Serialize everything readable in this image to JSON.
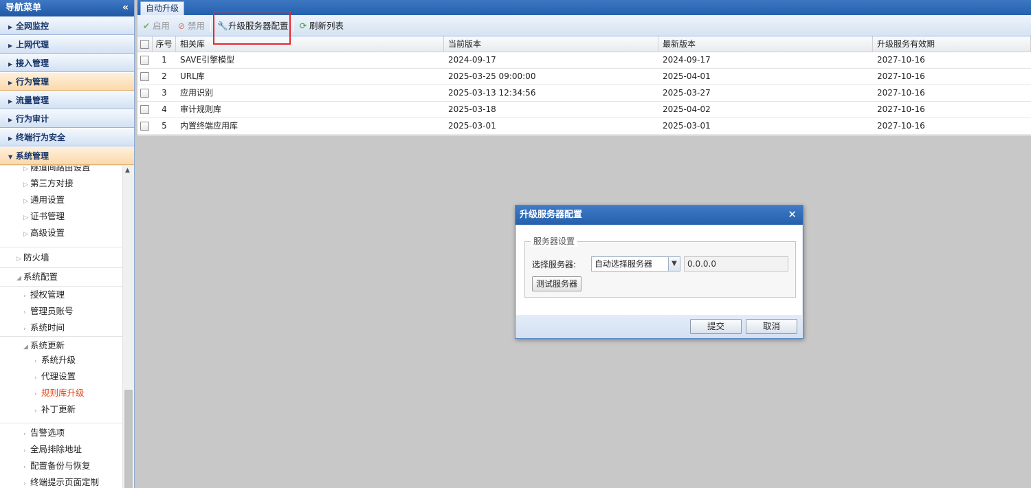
{
  "sidebar": {
    "title": "导航菜单",
    "collapse_glyph": "«",
    "categories": [
      {
        "label": "全网监控"
      },
      {
        "label": "上网代理"
      },
      {
        "label": "接入管理"
      },
      {
        "label": "行为管理"
      },
      {
        "label": "流量管理"
      },
      {
        "label": "行为审计"
      },
      {
        "label": "终端行为安全"
      },
      {
        "label": "系统管理"
      }
    ],
    "tree": [
      {
        "label": "隧道间路由设置"
      },
      {
        "label": "第三方对接"
      },
      {
        "label": "通用设置"
      },
      {
        "label": "证书管理"
      },
      {
        "label": "高级设置"
      },
      {
        "label": "防火墙"
      },
      {
        "label": "系统配置"
      },
      {
        "label": "授权管理"
      },
      {
        "label": "管理员账号"
      },
      {
        "label": "系统时间"
      },
      {
        "label": "系统更新"
      },
      {
        "label": "系统升级"
      },
      {
        "label": "代理设置"
      },
      {
        "label": "规则库升级"
      },
      {
        "label": "补丁更新"
      },
      {
        "label": "告警选项"
      },
      {
        "label": "全局排除地址"
      },
      {
        "label": "配置备份与恢复"
      },
      {
        "label": "终端提示页面定制"
      }
    ]
  },
  "tabs": [
    {
      "label": "自动升级"
    }
  ],
  "toolbar": {
    "enable_label": "启用",
    "disable_label": "禁用",
    "server_config_label": "升级服务器配置",
    "refresh_label": "刷新列表"
  },
  "grid": {
    "headers": {
      "no": "序号",
      "library": "相关库",
      "current": "当前版本",
      "latest": "最新版本",
      "expiry": "升级服务有效期"
    },
    "rows": [
      {
        "no": "1",
        "library": "SAVE引擎模型",
        "current": "2024-09-17",
        "latest": "2024-09-17",
        "expiry": "2027-10-16"
      },
      {
        "no": "2",
        "library": "URL库",
        "current": "2025-03-25 09:00:00",
        "latest": "2025-04-01",
        "expiry": "2027-10-16"
      },
      {
        "no": "3",
        "library": "应用识别",
        "current": "2025-03-13 12:34:56",
        "latest": "2025-03-27",
        "expiry": "2027-10-16"
      },
      {
        "no": "4",
        "library": "审计规则库",
        "current": "2025-03-18",
        "latest": "2025-04-02",
        "expiry": "2027-10-16"
      },
      {
        "no": "5",
        "library": "内置终端应用库",
        "current": "2025-03-01",
        "latest": "2025-03-01",
        "expiry": "2027-10-16"
      }
    ]
  },
  "dialog": {
    "title": "升级服务器配置",
    "fieldset_legend": "服务器设置",
    "select_label": "选择服务器:",
    "select_value": "自动选择服务器",
    "ip_value": "0.0.0.0",
    "test_button": "测试服务器",
    "submit_button": "提交",
    "cancel_button": "取消"
  },
  "colors": {
    "accent": "#2560ad",
    "active_item": "#e24a1f",
    "highlight_box": "#e5282f"
  },
  "icons": {
    "enable": "check-icon",
    "disable": "forbidden-icon",
    "server_config": "wrench-icon",
    "refresh": "refresh-icon"
  }
}
